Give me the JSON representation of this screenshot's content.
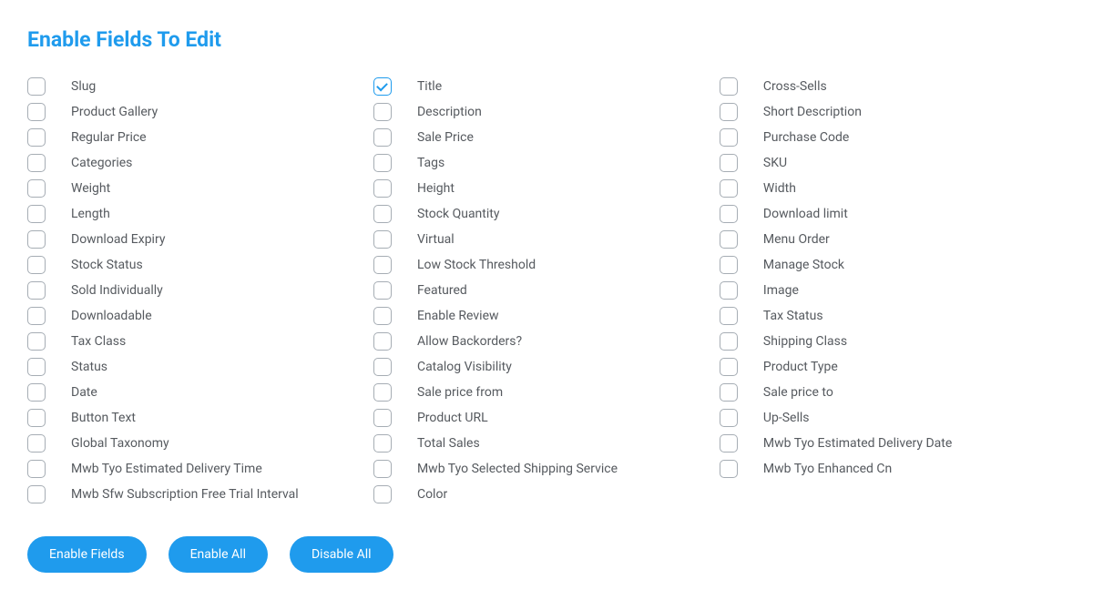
{
  "heading": "Enable Fields To Edit",
  "fields": [
    {
      "label": "Slug",
      "checked": false
    },
    {
      "label": "Title",
      "checked": true
    },
    {
      "label": "Cross-Sells",
      "checked": false
    },
    {
      "label": "Product Gallery",
      "checked": false
    },
    {
      "label": "Description",
      "checked": false
    },
    {
      "label": "Short Description",
      "checked": false
    },
    {
      "label": "Regular Price",
      "checked": false
    },
    {
      "label": "Sale Price",
      "checked": false
    },
    {
      "label": "Purchase Code",
      "checked": false
    },
    {
      "label": "Categories",
      "checked": false
    },
    {
      "label": "Tags",
      "checked": false
    },
    {
      "label": "SKU",
      "checked": false
    },
    {
      "label": "Weight",
      "checked": false
    },
    {
      "label": "Height",
      "checked": false
    },
    {
      "label": "Width",
      "checked": false
    },
    {
      "label": "Length",
      "checked": false
    },
    {
      "label": "Stock Quantity",
      "checked": false
    },
    {
      "label": "Download limit",
      "checked": false
    },
    {
      "label": "Download Expiry",
      "checked": false
    },
    {
      "label": "Virtual",
      "checked": false
    },
    {
      "label": "Menu Order",
      "checked": false
    },
    {
      "label": "Stock Status",
      "checked": false
    },
    {
      "label": "Low Stock Threshold",
      "checked": false
    },
    {
      "label": "Manage Stock",
      "checked": false
    },
    {
      "label": "Sold Individually",
      "checked": false
    },
    {
      "label": "Featured",
      "checked": false
    },
    {
      "label": "Image",
      "checked": false
    },
    {
      "label": "Downloadable",
      "checked": false
    },
    {
      "label": "Enable Review",
      "checked": false
    },
    {
      "label": "Tax Status",
      "checked": false
    },
    {
      "label": "Tax Class",
      "checked": false
    },
    {
      "label": "Allow Backorders?",
      "checked": false
    },
    {
      "label": "Shipping Class",
      "checked": false
    },
    {
      "label": "Status",
      "checked": false
    },
    {
      "label": "Catalog Visibility",
      "checked": false
    },
    {
      "label": "Product Type",
      "checked": false
    },
    {
      "label": "Date",
      "checked": false
    },
    {
      "label": "Sale price from",
      "checked": false
    },
    {
      "label": "Sale price to",
      "checked": false
    },
    {
      "label": "Button Text",
      "checked": false
    },
    {
      "label": "Product URL",
      "checked": false
    },
    {
      "label": "Up-Sells",
      "checked": false
    },
    {
      "label": "Global Taxonomy",
      "checked": false
    },
    {
      "label": "Total Sales",
      "checked": false
    },
    {
      "label": "Mwb Tyo Estimated Delivery Date",
      "checked": false
    },
    {
      "label": "Mwb Tyo Estimated Delivery Time",
      "checked": false
    },
    {
      "label": "Mwb Tyo Selected Shipping Service",
      "checked": false
    },
    {
      "label": "Mwb Tyo Enhanced Cn",
      "checked": false
    },
    {
      "label": "Mwb Sfw Subscription Free Trial Interval",
      "checked": false
    },
    {
      "label": "Color",
      "checked": false
    }
  ],
  "buttons": {
    "enable_fields": "Enable Fields",
    "enable_all": "Enable All",
    "disable_all": "Disable All"
  }
}
